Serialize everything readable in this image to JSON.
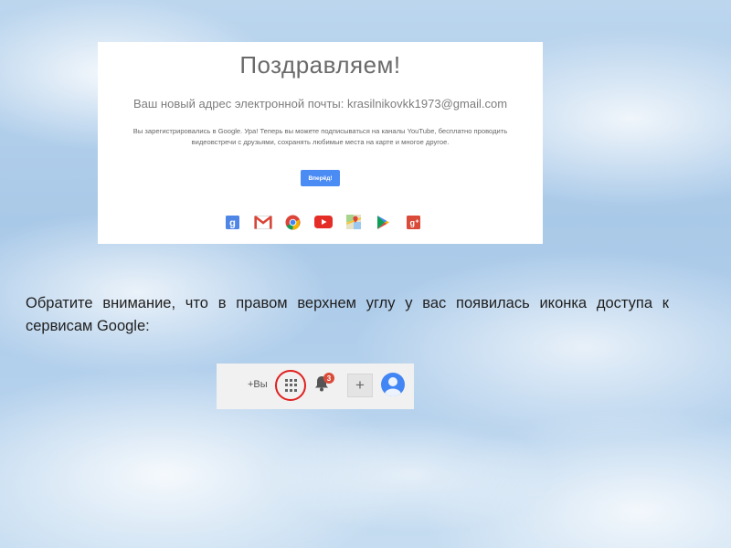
{
  "signup": {
    "title": "Поздравляем!",
    "email_line": "Ваш новый адрес электронной почты: krasilnikovkk1973@gmail.com",
    "description": "Вы зарегистрировались в Google. Ура! Теперь вы можете подписываться на каналы YouTube, бесплатно проводить видеовстречи с друзьями, сохранять любимые места на карте и многое другое.",
    "continue_label": "Вперёд!",
    "services": [
      "google-plus-icon",
      "gmail-icon",
      "chrome-icon",
      "youtube-icon",
      "maps-icon",
      "play-icon",
      "google-plus-red-icon"
    ]
  },
  "paragraph": "Обратите внимание, что в правом верхнем углу у вас появилась иконка доступа к сервисам Google:",
  "topbar": {
    "plus_you": "+Вы",
    "notification_count": "3",
    "add_label": "+"
  },
  "colors": {
    "accent_blue": "#4b8bf4",
    "highlight_red": "#e02020",
    "badge_red": "#d94a38"
  }
}
